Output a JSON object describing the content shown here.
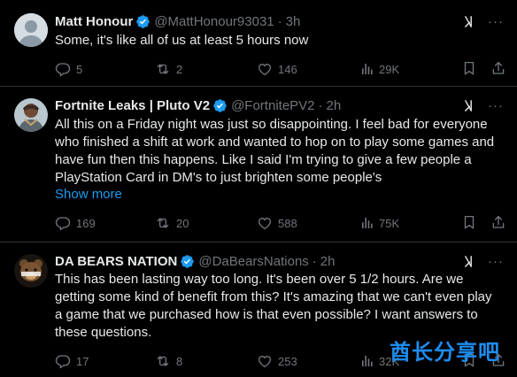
{
  "tweets": [
    {
      "name": "Matt Honour",
      "handle": "@MattHonour93031",
      "dot": "·",
      "time": "3h",
      "text": "Some, it's like all of us at least 5 hours now",
      "replies": "5",
      "reposts": "2",
      "likes": "146",
      "views": "29K",
      "avatar": "default-avatar"
    },
    {
      "name": "Fortnite Leaks | Pluto V2",
      "handle": "@FortnitePV2",
      "dot": "·",
      "time": "2h",
      "lines": [
        "All this on a Friday night was just so disappointing. I feel bad for everyone",
        "who finished a shift at work and wanted to hop on to play some games and",
        "have fun then this happens. Like I said I'm trying to give a few people a",
        "PlayStation Card in DM's to just brighten some people's"
      ],
      "show_more": "Show more",
      "replies": "169",
      "reposts": "20",
      "likes": "588",
      "views": "75K",
      "avatar": "character-avatar"
    },
    {
      "name": "DA BEARS NATION",
      "handle": "@DaBearsNations",
      "dot": "·",
      "time": "2h",
      "lines": [
        "This has been lasting way too long. It's been over 5 1/2 hours. Are we",
        "getting some kind of benefit from this? It's amazing that we can't even play",
        "a game that we purchased how is that even possible? I want answers to",
        "these questions."
      ],
      "replies": "17",
      "reposts": "8",
      "likes": "253",
      "views": "32K",
      "avatar": "bear-logo-avatar"
    }
  ],
  "watermark": "酋长分享吧",
  "colors": {
    "background": "#000000",
    "text": "#e7e9ea",
    "muted": "#71767b",
    "accent": "#1d9bf0",
    "divider": "#2f3336"
  }
}
